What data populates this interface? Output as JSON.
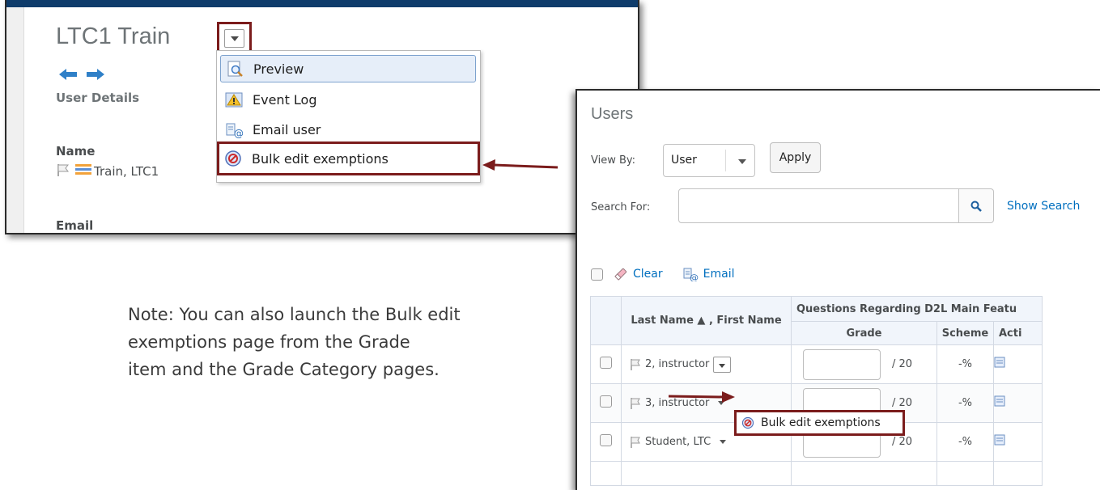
{
  "panel_left": {
    "title": "LTC1 Train",
    "user_details_label": "User Details",
    "name_label": "Name",
    "name_value": "Train, LTC1",
    "email_label": "Email"
  },
  "context_menu": {
    "items": [
      {
        "label": "Preview",
        "icon": "preview-icon"
      },
      {
        "label": "Event Log",
        "icon": "warning-icon"
      },
      {
        "label": "Email user",
        "icon": "email-icon"
      },
      {
        "label": "Bulk edit exemptions",
        "icon": "exempt-icon"
      }
    ]
  },
  "note": {
    "line1": "Note: You can also launch the Bulk edit",
    "line2": "exemptions page from the Grade",
    "line3": "item and the Grade Category pages."
  },
  "panel_right": {
    "title": "Users",
    "view_by_label": "View By:",
    "view_by_value": "User",
    "apply_label": "Apply",
    "search_label": "Search For:",
    "search_value": "",
    "show_search_label": "Show Search",
    "clear_label": "Clear",
    "email_label": "Email",
    "table": {
      "col_name": "Last Name ▲ , First Name",
      "col_group": "Questions Regarding D2L Main Featu",
      "col_grade": "Grade",
      "col_scheme": "Scheme",
      "col_action": "Acti",
      "rows": [
        {
          "name": "2, instructor",
          "grade_max": "/ 20",
          "scheme": "-%"
        },
        {
          "name": "3, instructor",
          "grade_max": "/ 20",
          "scheme": "-%"
        },
        {
          "name": "Student, LTC",
          "grade_max": "/ 20",
          "scheme": "-%"
        }
      ]
    },
    "row_menu_label": "Bulk edit exemptions"
  },
  "colors": {
    "highlight_border": "#7b1c1c",
    "link": "#006fbf",
    "header_bar": "#0f3c6b"
  }
}
